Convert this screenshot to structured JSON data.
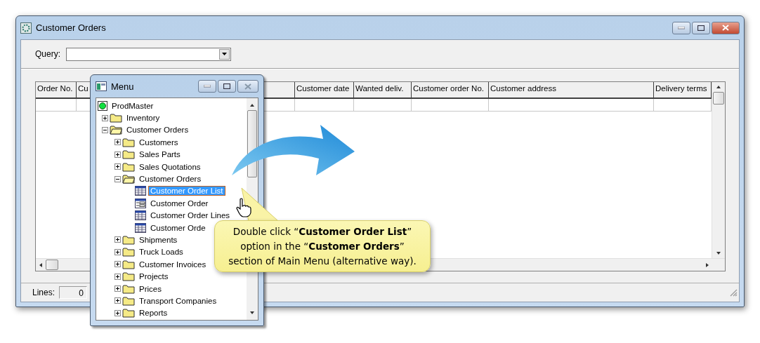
{
  "main_window": {
    "title": "Customer Orders",
    "query": {
      "label": "Query:"
    },
    "table": {
      "columns": [
        "Order No.",
        "Cu",
        "Customer date",
        "Wanted deliv.",
        "Customer order No.",
        "Customer address",
        "Delivery terms"
      ]
    },
    "status_bar": {
      "label": "Lines:",
      "value": "0"
    }
  },
  "menu_window": {
    "title": "Menu",
    "tree": [
      {
        "label": "ProdMaster",
        "kind": "root",
        "selected": false,
        "children": [
          {
            "label": "Inventory",
            "kind": "folder",
            "expanded": false,
            "selected": false
          },
          {
            "label": "Customer Orders",
            "kind": "folder",
            "expanded": true,
            "selected": false,
            "children": [
              {
                "label": "Customers",
                "kind": "folder",
                "expanded": false,
                "selected": false
              },
              {
                "label": "Sales Parts",
                "kind": "folder",
                "expanded": false,
                "selected": false
              },
              {
                "label": "Sales Quotations",
                "kind": "folder",
                "expanded": false,
                "selected": false
              },
              {
                "label": "Customer Orders",
                "kind": "folder",
                "expanded": true,
                "selected": false,
                "children": [
                  {
                    "label": "Customer Order List",
                    "kind": "list",
                    "selected": true
                  },
                  {
                    "label": "Customer Order",
                    "kind": "form",
                    "selected": false
                  },
                  {
                    "label": "Customer Order Lines",
                    "kind": "list",
                    "selected": false
                  },
                  {
                    "label": "Customer Orde",
                    "kind": "list",
                    "selected": false
                  }
                ]
              },
              {
                "label": "Shipments",
                "kind": "folder",
                "expanded": false,
                "selected": false
              },
              {
                "label": "Truck Loads",
                "kind": "folder",
                "expanded": false,
                "selected": false
              },
              {
                "label": "Customer Invoices",
                "kind": "folder",
                "expanded": false,
                "selected": false
              },
              {
                "label": "Projects",
                "kind": "folder",
                "expanded": false,
                "selected": false
              },
              {
                "label": "Prices",
                "kind": "folder",
                "expanded": false,
                "selected": false
              },
              {
                "label": "Transport Companies",
                "kind": "folder",
                "expanded": false,
                "selected": false
              },
              {
                "label": "Reports",
                "kind": "folder",
                "expanded": false,
                "selected": false
              }
            ]
          }
        ]
      }
    ]
  },
  "callout": {
    "text": "Double click “**Customer Order List**” option in the “**Customer Orders**” section of Main Menu (alternative way)."
  }
}
